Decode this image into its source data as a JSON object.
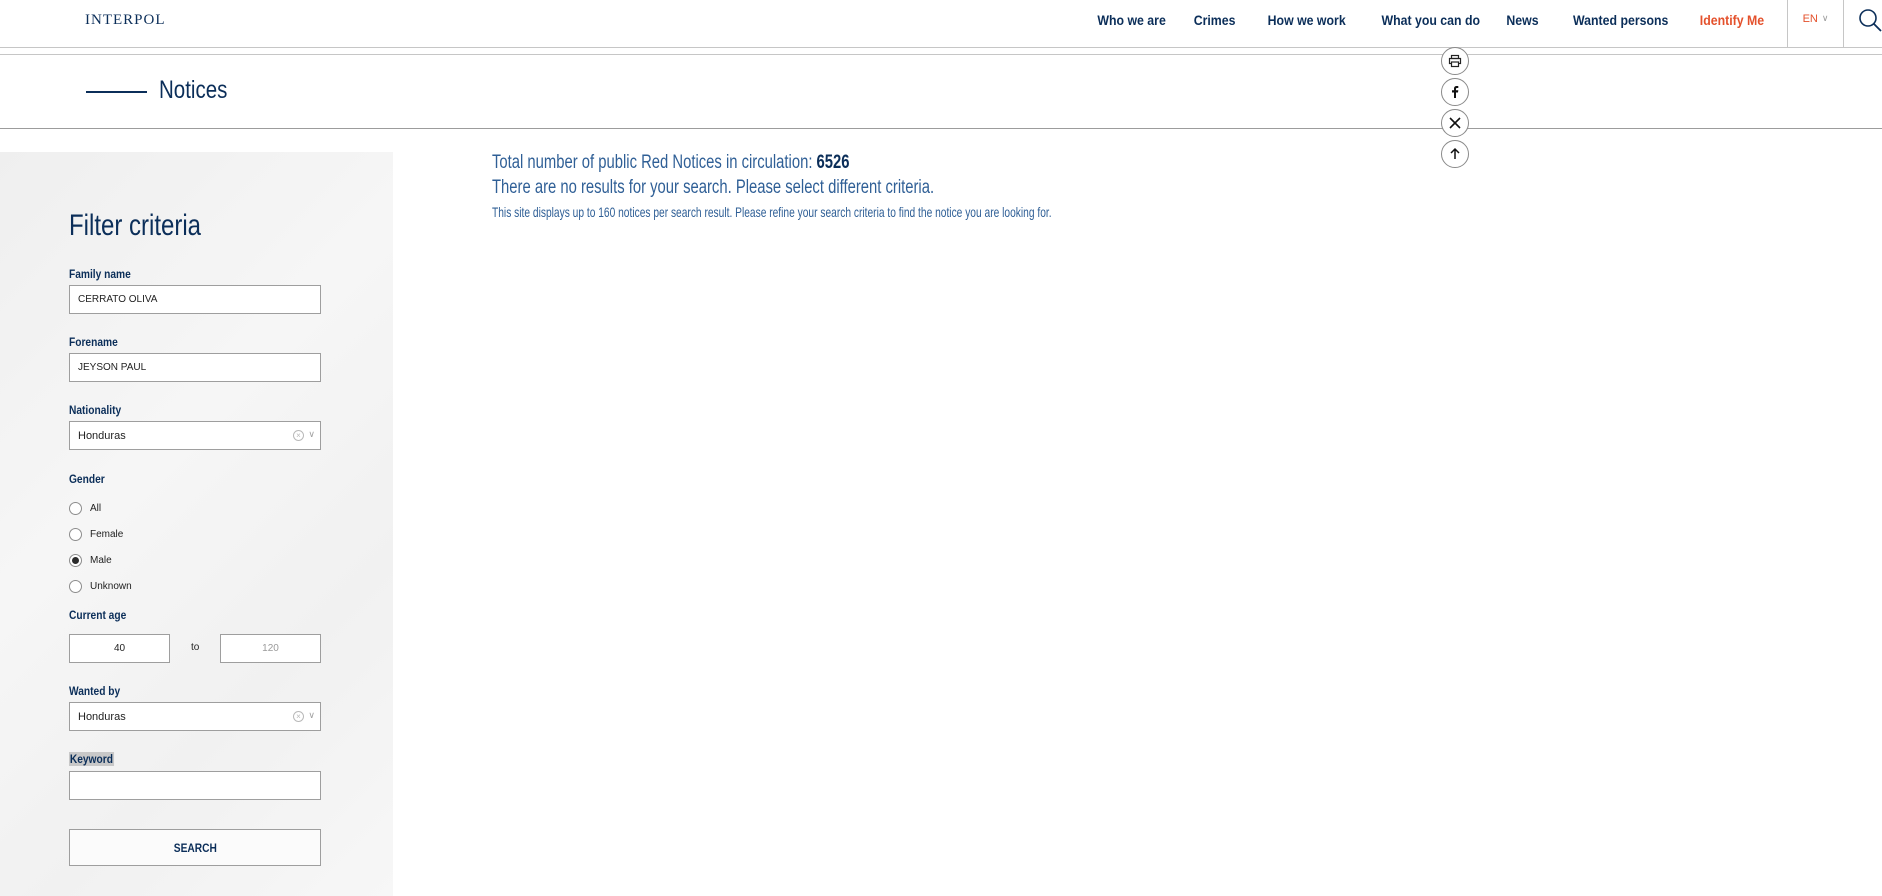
{
  "header": {
    "logo": "INTERPOL",
    "nav": [
      {
        "label": "Who we are"
      },
      {
        "label": "Crimes"
      },
      {
        "label": "How we work"
      },
      {
        "label": "What you can do"
      },
      {
        "label": "News"
      },
      {
        "label": "Wanted persons"
      },
      {
        "label": "Identify Me",
        "color": "#e4512c"
      }
    ],
    "language": "EN"
  },
  "page": {
    "title": "Notices"
  },
  "filter": {
    "title": "Filter criteria",
    "family_name_label": "Family name",
    "family_name_value": "CERRATO OLIVA",
    "forename_label": "Forename",
    "forename_value": "JEYSON PAUL",
    "nationality_label": "Nationality",
    "nationality_value": "Honduras",
    "gender_label": "Gender",
    "gender_options": [
      {
        "label": "All",
        "checked": false
      },
      {
        "label": "Female",
        "checked": false
      },
      {
        "label": "Male",
        "checked": true
      },
      {
        "label": "Unknown",
        "checked": false
      }
    ],
    "age_label": "Current age",
    "age_from_value": "40",
    "age_to_text": "to",
    "age_to_placeholder": "120",
    "wanted_by_label": "Wanted by",
    "wanted_by_value": "Honduras",
    "keyword_label": "Keyword",
    "keyword_value": "",
    "search_label": "SEARCH"
  },
  "results": {
    "total_text": "Total number of public Red Notices in circulation: ",
    "total_count": "6526",
    "no_results": "There are no results for your search. Please select different criteria.",
    "note": "This site displays up to 160 notices per search result. Please refine your search criteria to find the notice you are looking for."
  },
  "colors": {
    "brand": "#0b2e59",
    "accent": "#e4512c",
    "text_blue": "#2f5f96"
  }
}
